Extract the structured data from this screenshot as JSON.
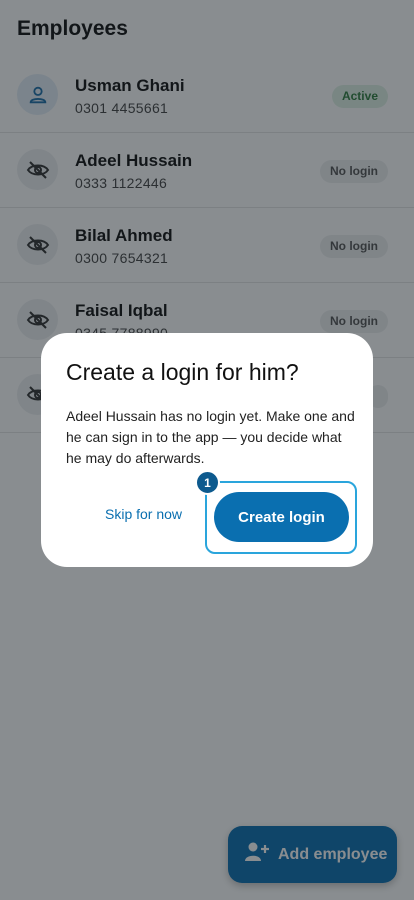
{
  "header": {
    "title": "Employees"
  },
  "employees": [
    {
      "name": "Usman Ghani",
      "phone": "0301 4455661",
      "status": "Active",
      "icon": "person-icon"
    },
    {
      "name": "Adeel Hussain",
      "phone": "0333 1122446",
      "status": "No login",
      "icon": "hidden-icon"
    },
    {
      "name": "Bilal Ahmed",
      "phone": "0300 7654321",
      "status": "No login",
      "icon": "hidden-icon"
    },
    {
      "name": "Faisal Iqbal",
      "phone": "0345 7788990",
      "status": "No login",
      "icon": "hidden-icon"
    },
    {
      "name": "",
      "phone": "",
      "status": "",
      "icon": "hidden-icon"
    }
  ],
  "fab": {
    "label": "Add employee",
    "icon": "add-person-icon"
  },
  "dialog": {
    "title": "Create a login for him?",
    "body": "Adeel Hussain has no login yet. Make one and he can sign in to the app — you decide what he may do afterwards.",
    "skip_label": "Skip for now",
    "create_label": "Create login",
    "step_number": "1"
  },
  "colors": {
    "accent": "#0a6fb0",
    "highlight": "#2aa5dc",
    "active_badge_bg": "#dff1e4",
    "active_badge_text": "#2f7d3e"
  }
}
